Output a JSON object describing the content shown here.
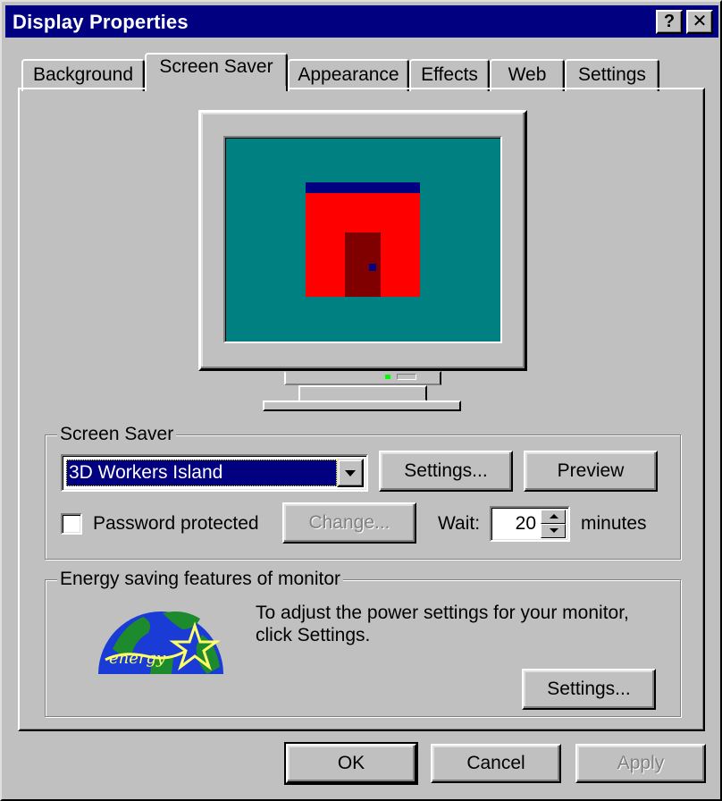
{
  "window": {
    "title": "Display Properties",
    "help_button": "?",
    "close_button": "✕"
  },
  "tabs": [
    {
      "label": "Background"
    },
    {
      "label": "Screen Saver",
      "active": true
    },
    {
      "label": "Appearance"
    },
    {
      "label": "Effects"
    },
    {
      "label": "Web"
    },
    {
      "label": "Settings"
    }
  ],
  "screen_saver": {
    "group_label": "Screen Saver",
    "selected": "3D Workers Island",
    "settings_button": "Settings...",
    "preview_button": "Preview",
    "password_label": "Password protected",
    "password_checked": false,
    "change_button": "Change...",
    "wait_label": "Wait:",
    "wait_value": "20",
    "minutes_label": "minutes"
  },
  "energy": {
    "group_label": "Energy saving features of monitor",
    "description_line1": "To adjust the power settings for your monitor,",
    "description_line2": "click Settings.",
    "settings_button": "Settings...",
    "logo_text": "energy"
  },
  "footer": {
    "ok": "OK",
    "cancel": "Cancel",
    "apply": "Apply"
  },
  "colors": {
    "titlebar": "#000080",
    "face": "#c0c0c0",
    "preview_background": "#008080",
    "house": "#ff0000",
    "roof": "#000080",
    "door": "#800000"
  }
}
